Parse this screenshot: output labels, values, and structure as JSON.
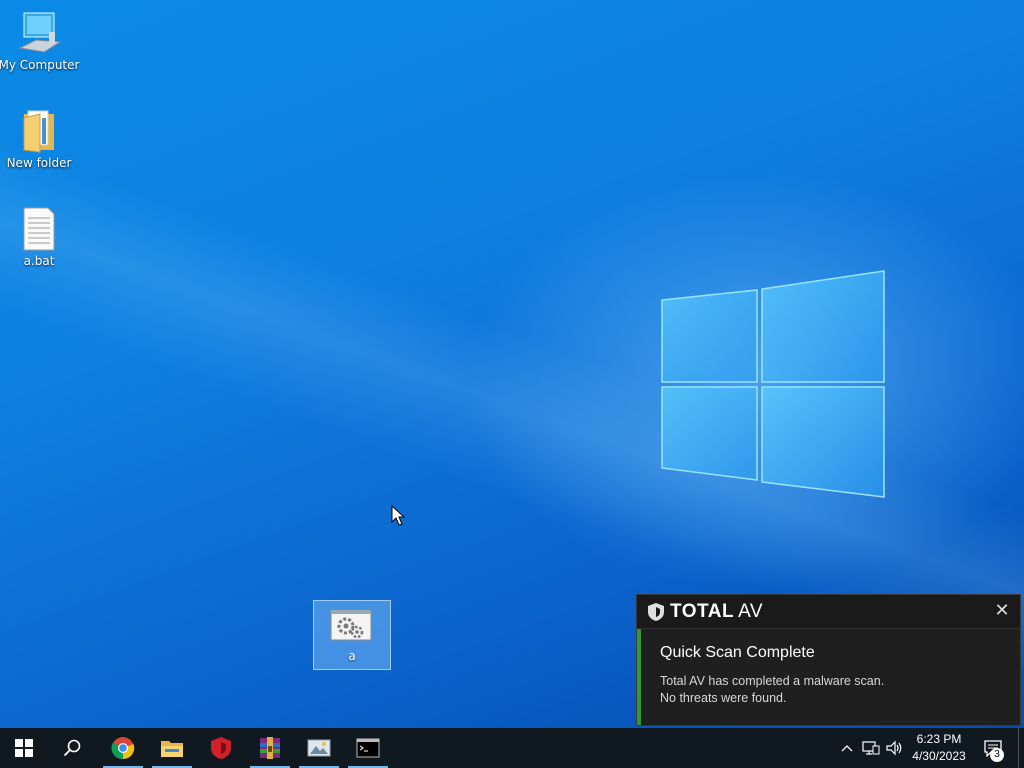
{
  "desktop": {
    "icons": [
      {
        "label": "My Computer",
        "icon": "computer-icon"
      },
      {
        "label": "New folder",
        "icon": "folder-icon"
      },
      {
        "label": "a.bat",
        "icon": "batch-file-icon"
      }
    ],
    "selected_icon": {
      "label": "a",
      "icon": "application-gears-icon"
    }
  },
  "notification": {
    "brand": "TOTAL",
    "brand_suffix": "AV",
    "title": "Quick Scan Complete",
    "line1": "Total AV has completed a malware scan.",
    "line2": "No threats were found.",
    "close_icon": "close-icon",
    "accent_color": "#2e9a3a"
  },
  "taskbar": {
    "apps": [
      {
        "name": "start",
        "icon": "windows-start-icon"
      },
      {
        "name": "search",
        "icon": "search-icon"
      },
      {
        "name": "chrome",
        "icon": "chrome-icon"
      },
      {
        "name": "file-explorer",
        "icon": "folder-icon"
      },
      {
        "name": "total-av",
        "icon": "shield-icon"
      },
      {
        "name": "winrar",
        "icon": "winrar-icon"
      },
      {
        "name": "image-viewer",
        "icon": "image-icon"
      },
      {
        "name": "command-prompt",
        "icon": "cmd-icon"
      }
    ],
    "clock": {
      "time": "6:23 PM",
      "date": "4/30/2023"
    },
    "notification_count": "3"
  }
}
